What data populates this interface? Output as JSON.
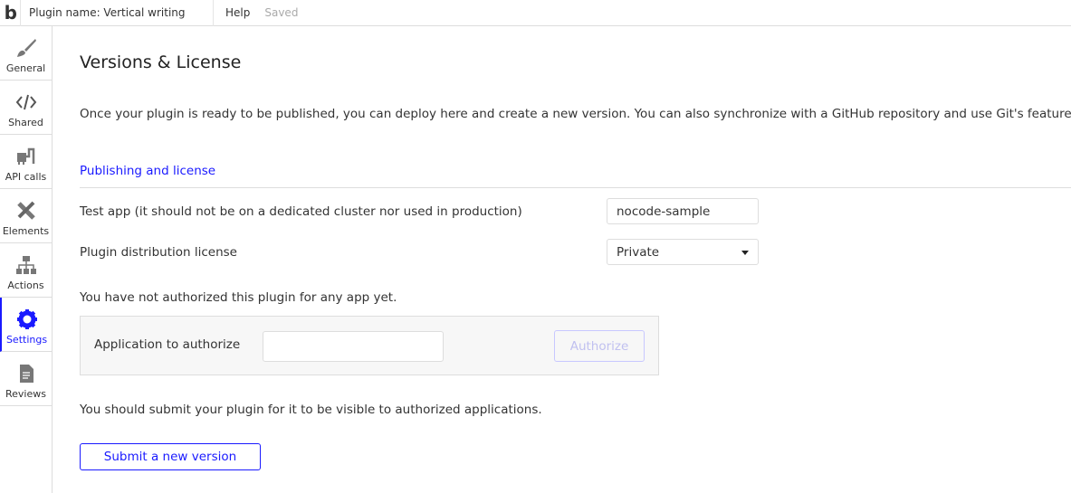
{
  "header": {
    "logo": "b",
    "plugin_name": "Plugin name: Vertical writing",
    "help": "Help",
    "status": "Saved"
  },
  "sidebar": {
    "items": [
      {
        "label": "General",
        "icon": "brush-icon"
      },
      {
        "label": "Shared",
        "icon": "code-icon"
      },
      {
        "label": "API calls",
        "icon": "plug-icon"
      },
      {
        "label": "Elements",
        "icon": "tools-icon"
      },
      {
        "label": "Actions",
        "icon": "sitemap-icon"
      },
      {
        "label": "Settings",
        "icon": "gear-icon",
        "active": true
      },
      {
        "label": "Reviews",
        "icon": "document-icon"
      }
    ]
  },
  "main": {
    "title": "Versions & License",
    "intro": "Once your plugin is ready to be published, you can deploy here and create a new version. You can also synchronize with a GitHub repository and use Git's features.",
    "section": "Publishing and license",
    "test_app_label": "Test app (it should not be on a dedicated cluster nor used in production)",
    "test_app_value": "nocode-sample",
    "license_label": "Plugin distribution license",
    "license_value": "Private",
    "not_authorized": "You have not authorized this plugin for any app yet.",
    "auth_label": "Application to authorize",
    "auth_value": "",
    "auth_button": "Authorize",
    "submit_note": "You should submit your plugin for it to be visible to authorized applications.",
    "submit_button": "Submit a new version"
  },
  "colors": {
    "accent": "#1a1aff",
    "icon": "#777777"
  }
}
